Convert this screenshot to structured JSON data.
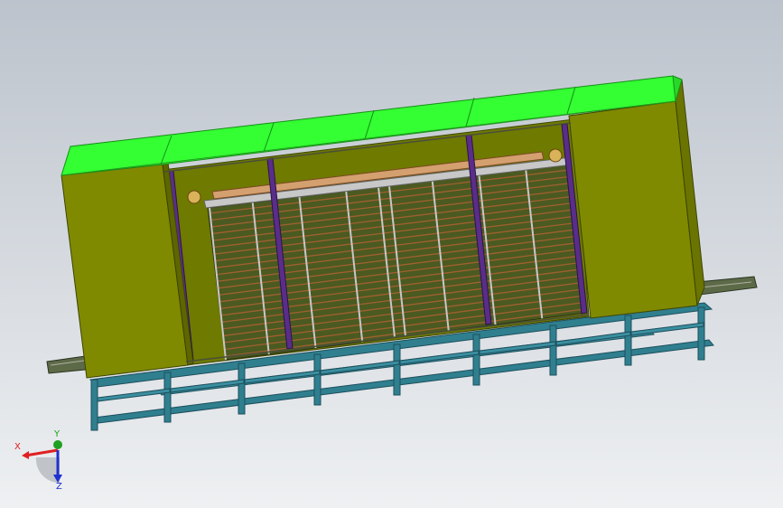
{
  "viewport": {
    "background_top": "#bcc3cc",
    "background_bottom": "#eef0f2"
  },
  "model": {
    "roof_color": "#33ff33",
    "panel_color": "#7f8a00",
    "frame_color": "#2f7f8f",
    "roller_color": "#a06030",
    "post_color": "#5a2d8a"
  },
  "triad": {
    "x_label": "X",
    "y_label": "Y",
    "z_label": "Z",
    "x_color": "#e02020",
    "y_color": "#20a020",
    "z_color": "#2030d0"
  }
}
